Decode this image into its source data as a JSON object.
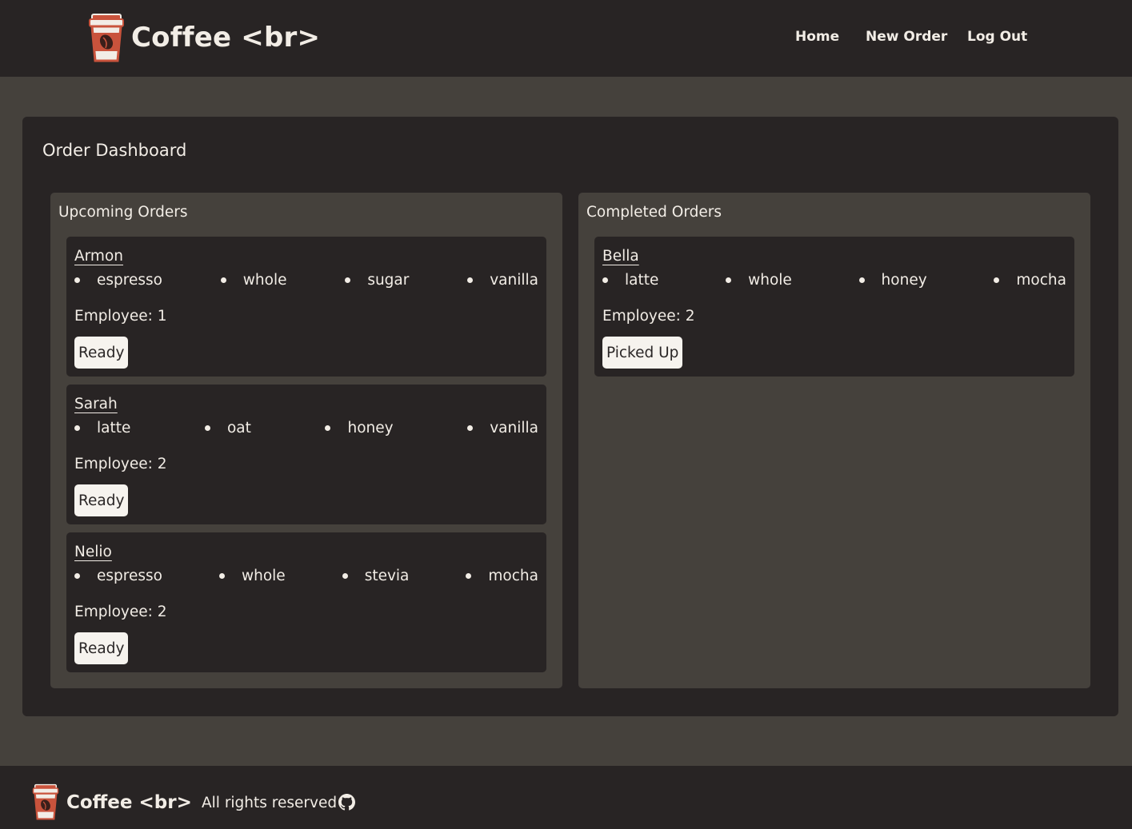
{
  "header": {
    "brand": "Coffee <br>",
    "nav": [
      {
        "label": "Home"
      },
      {
        "label": "New Order"
      },
      {
        "label": "Log Out"
      }
    ]
  },
  "dashboard": {
    "title": "Order Dashboard",
    "upcoming": {
      "title": "Upcoming Orders",
      "orders": [
        {
          "name": "Armon",
          "ingredients": [
            "espresso",
            "whole",
            "sugar",
            "vanilla"
          ],
          "employee": "Employee: 1",
          "button": "Ready"
        },
        {
          "name": "Sarah",
          "ingredients": [
            "latte",
            "oat",
            "honey",
            "vanilla"
          ],
          "employee": "Employee: 2",
          "button": "Ready"
        },
        {
          "name": "Nelio",
          "ingredients": [
            "espresso",
            "whole",
            "stevia",
            "mocha"
          ],
          "employee": "Employee: 2",
          "button": "Ready"
        }
      ]
    },
    "completed": {
      "title": "Completed Orders",
      "orders": [
        {
          "name": "Bella",
          "ingredients": [
            "latte",
            "whole",
            "honey",
            "mocha"
          ],
          "employee": "Employee: 2",
          "button": "Picked Up"
        }
      ]
    }
  },
  "footer": {
    "brand": "Coffee <br>",
    "rights": "All rights reserved",
    "icon": "github-icon"
  },
  "colors": {
    "header_bg": "#282424",
    "page_bg": "#45413c",
    "panel_bg": "#282424",
    "text": "#f2ede6",
    "button_bg": "#f6f3ee"
  }
}
